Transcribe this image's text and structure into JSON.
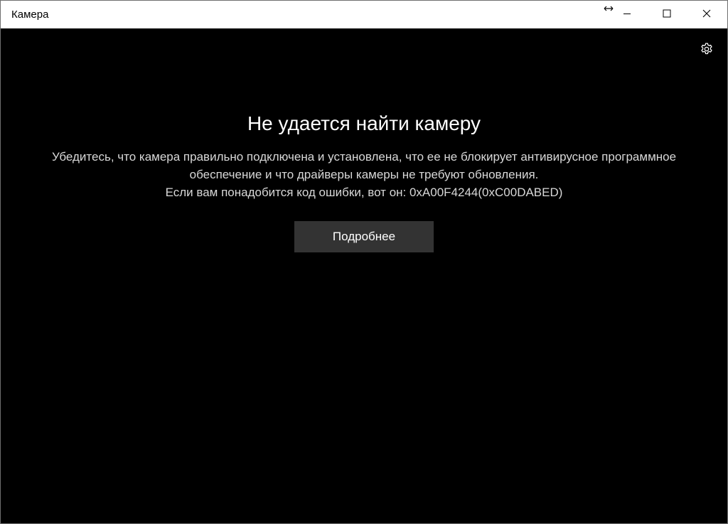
{
  "window": {
    "title": "Камера"
  },
  "titlebar": {
    "controls": {
      "minimize_icon": "minimize-icon",
      "maximize_icon": "maximize-icon",
      "close_icon": "close-icon"
    }
  },
  "toolbar": {
    "settings_icon": "gear-icon"
  },
  "error": {
    "title": "Не удается найти камеру",
    "line1": "Убедитесь, что камера правильно подключена и установлена, что ее не блокирует антивирусное программное",
    "line2": "обеспечение и что драйверы камеры не требуют обновления.",
    "line3": "Если вам понадобится код ошибки, вот он: 0xA00F4244(0xC00DABED)"
  },
  "actions": {
    "details_label": "Подробнее"
  },
  "colors": {
    "background": "#000000",
    "titlebar": "#ffffff",
    "button": "#333333",
    "text": "#ffffff"
  }
}
